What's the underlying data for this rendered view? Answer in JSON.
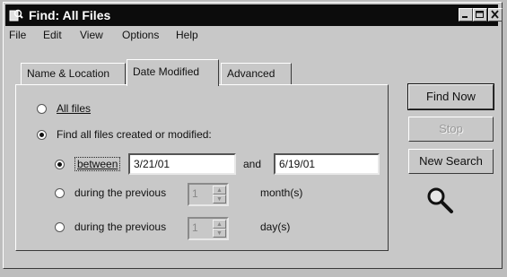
{
  "window": {
    "title": "Find: All Files"
  },
  "menu": [
    "File",
    "Edit",
    "View",
    "Options",
    "Help"
  ],
  "tabs": [
    {
      "label": "Name & Location"
    },
    {
      "label": "Date Modified"
    },
    {
      "label": "Advanced"
    }
  ],
  "options": {
    "all_files": "All files",
    "find_all_files": "Find all files created or modified:",
    "between": "between",
    "start_date": "3/21/01",
    "and": "and",
    "end_date": "6/19/01",
    "during_previous_1": "during the previous",
    "months_value": "1",
    "months_unit": "month(s)",
    "during_previous_2": "during the previous",
    "days_value": "1",
    "days_unit": "day(s)"
  },
  "buttons": {
    "find_now": "Find Now",
    "stop": "Stop",
    "new_search": "New Search"
  }
}
